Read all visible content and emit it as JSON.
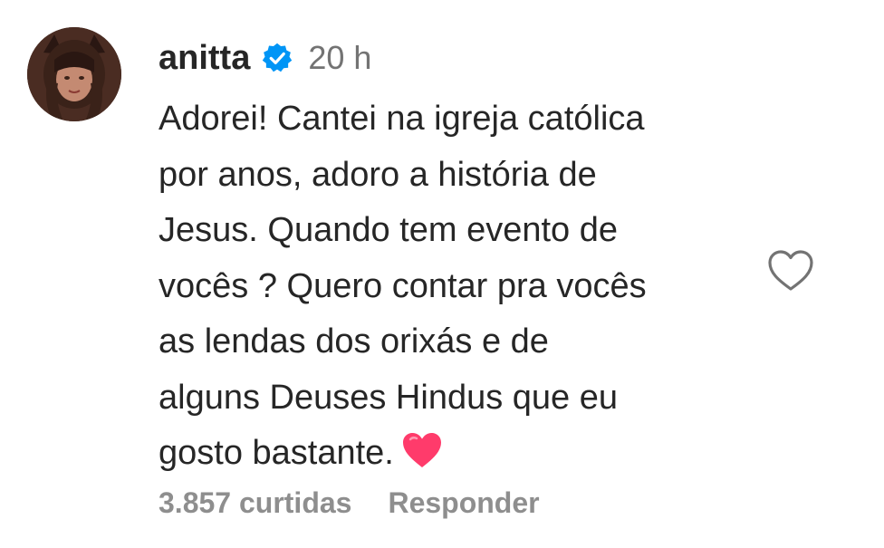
{
  "comment": {
    "username": "anitta",
    "verified": true,
    "timestamp": "20 h",
    "text_lines": [
      "Adorei! Cantei na igreja católica",
      "por anos, adoro a história de",
      "Jesus. Quando tem evento de",
      "vocês ? Quero contar pra vocês",
      "as lendas dos orixás e de",
      "alguns Deuses Hindus que eu",
      "gosto bastante."
    ],
    "emoji": "pink-heart",
    "likes_label": "3.857 curtidas",
    "reply_label": "Responder"
  },
  "icons": {
    "verified_badge": "verified-badge-icon",
    "like": "heart-outline-icon",
    "emoji": "pink-heart-emoji-icon"
  },
  "colors": {
    "username": "#262626",
    "text": "#262626",
    "muted": "#737373",
    "footer": "#8e8e8e",
    "verified_blue": "#0095f6",
    "emoji_heart": "#ff3b6b"
  }
}
